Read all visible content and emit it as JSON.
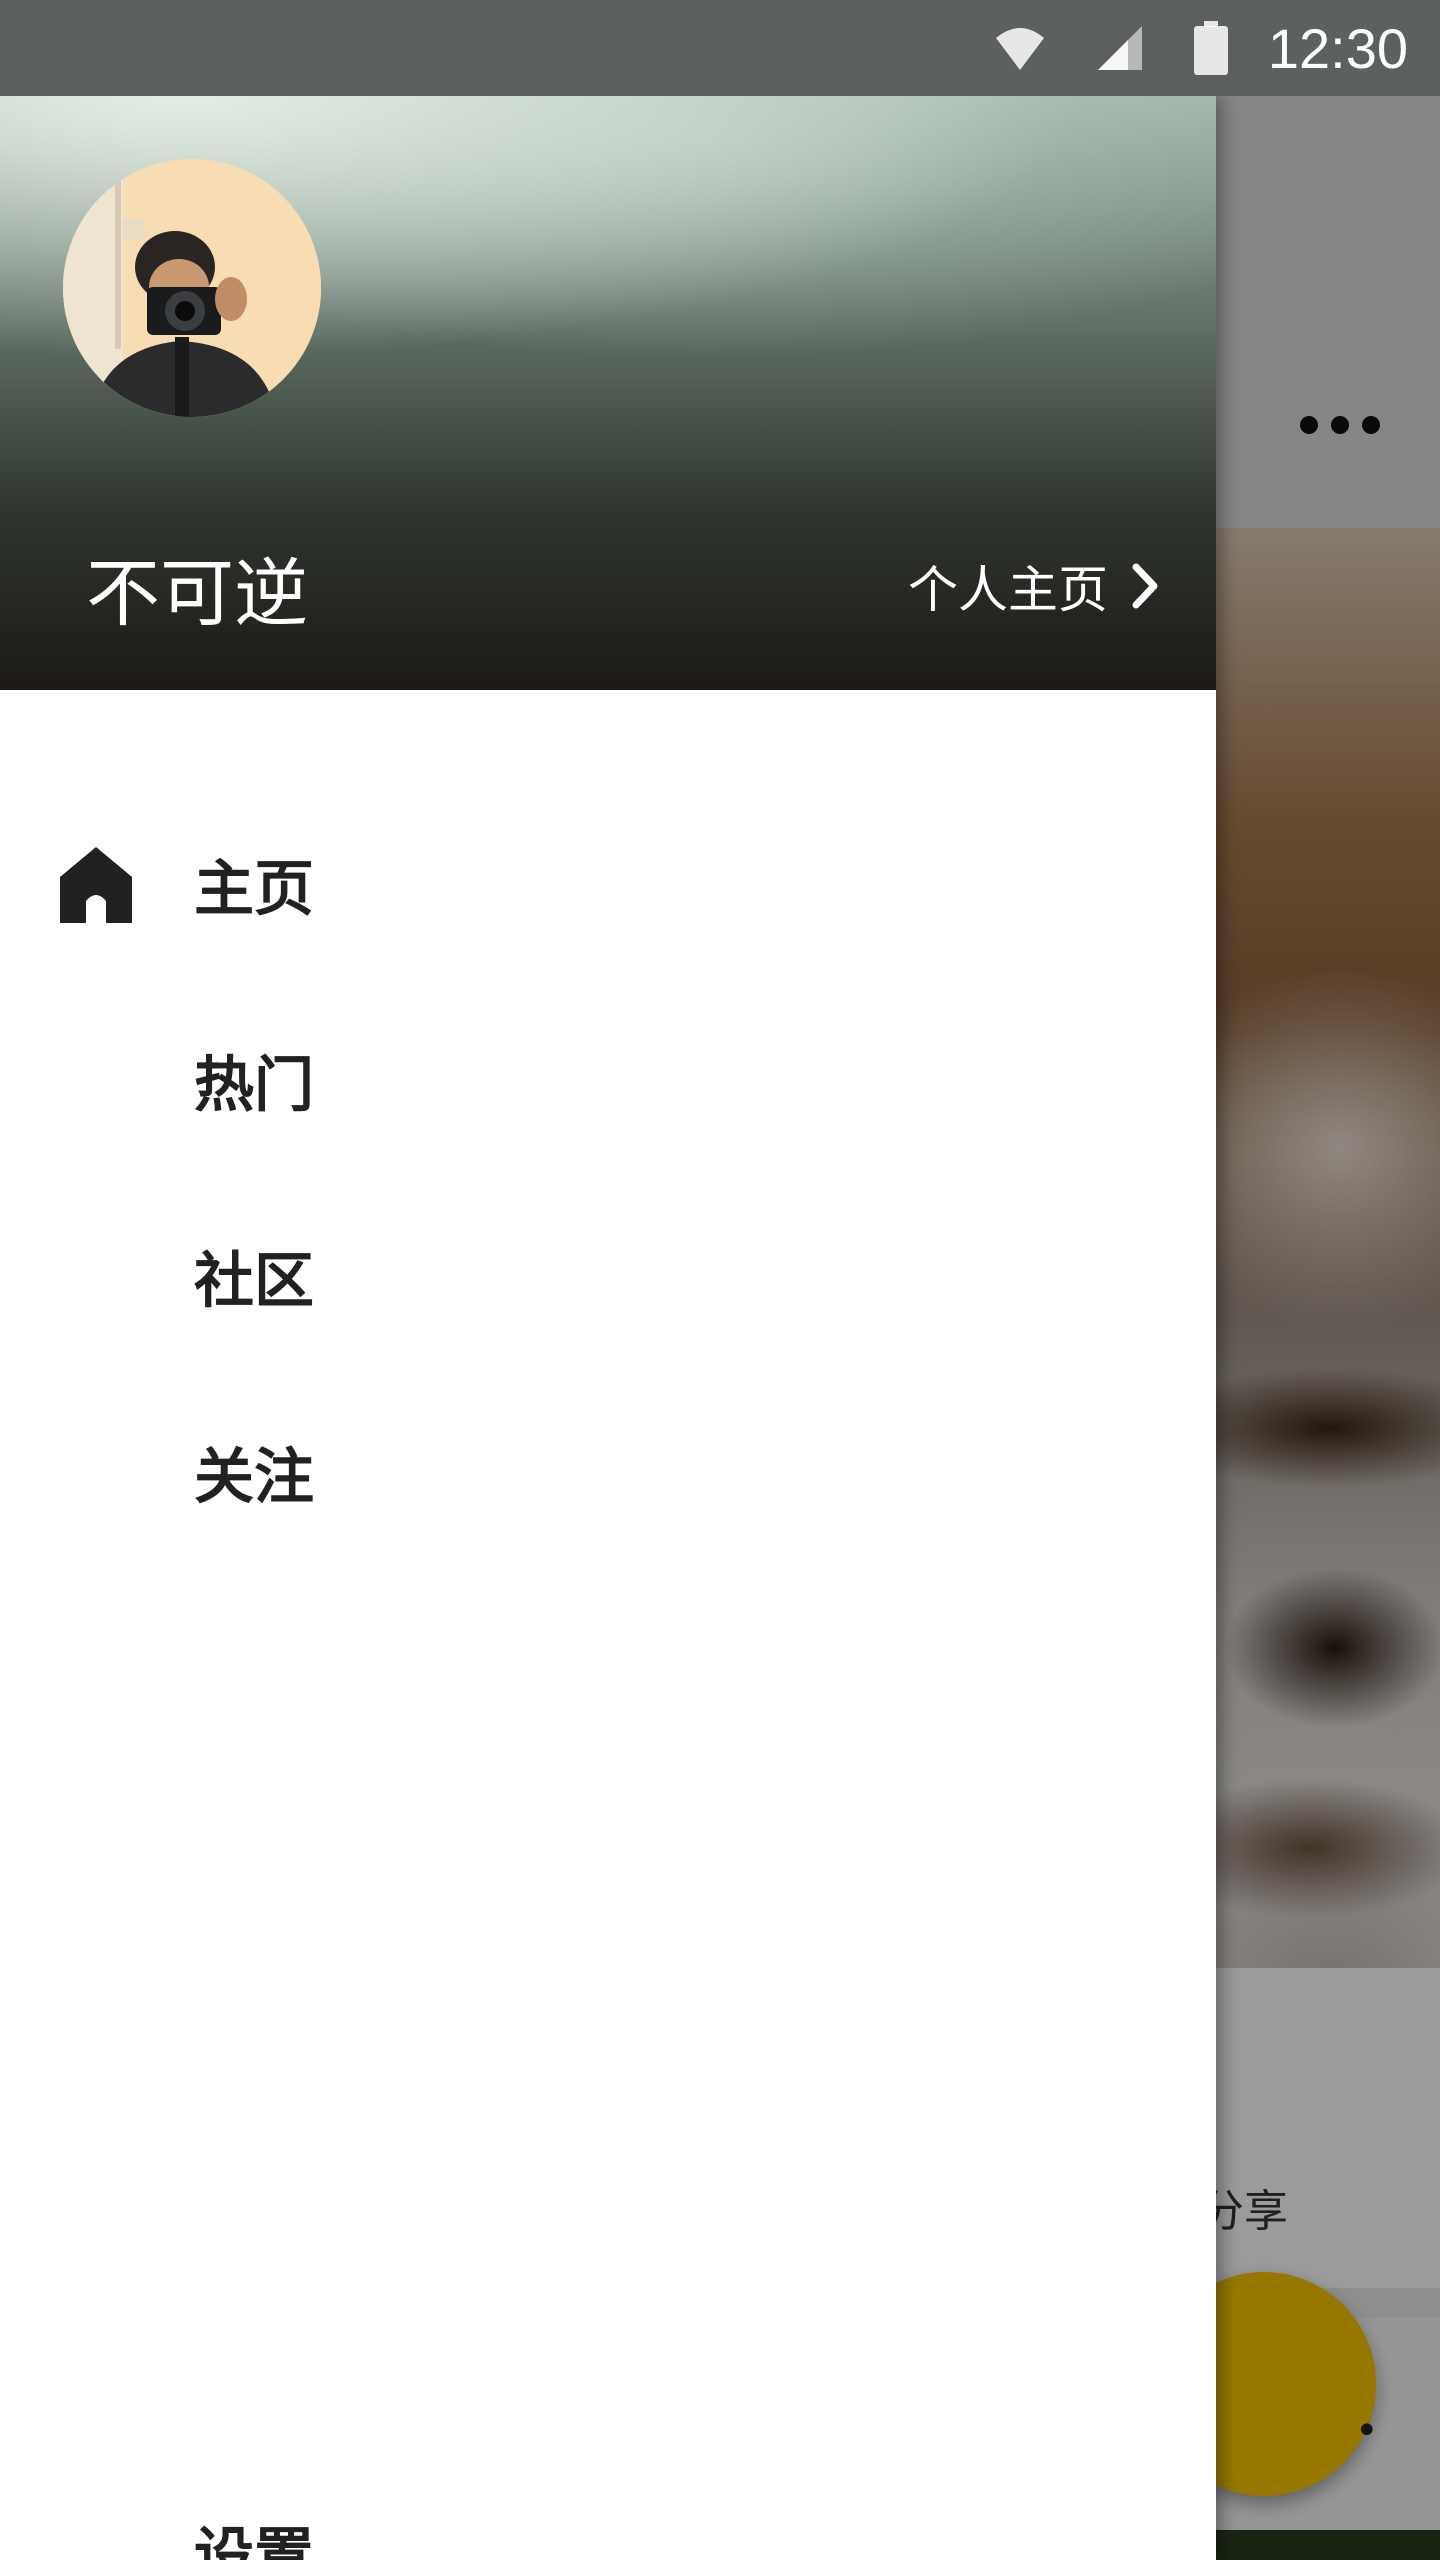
{
  "status_bar": {
    "time": "12:30",
    "icons": [
      "wifi-icon",
      "cellular-signal-icon",
      "battery-icon"
    ]
  },
  "drawer": {
    "header": {
      "username": "不可逆",
      "profile_link_label": "个人主页"
    },
    "menu_items": [
      {
        "label": "主页",
        "icon": "home-icon",
        "selected": true
      },
      {
        "label": "热门"
      },
      {
        "label": "社区"
      },
      {
        "label": "关注"
      }
    ],
    "settings_label": "设置"
  },
  "background_app": {
    "share_label": "分享",
    "fab_color": "#f3c200"
  },
  "colors": {
    "status_bar": "#5d615d",
    "drawer_bg": "#ffffff",
    "menu_text": "#212121"
  }
}
